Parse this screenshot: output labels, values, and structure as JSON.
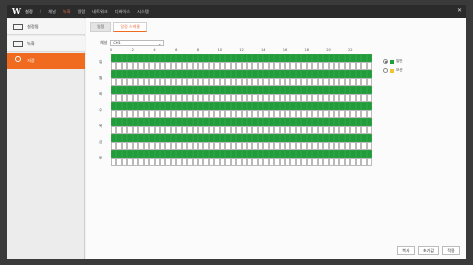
{
  "header": {
    "logo": "W",
    "menu": [
      {
        "label": "설정",
        "style": "group"
      },
      {
        "label": "/",
        "style": "sep"
      },
      {
        "label": "채널",
        "style": "normal"
      },
      {
        "label": "녹화",
        "style": "active"
      },
      {
        "label": "알람",
        "style": "normal"
      },
      {
        "label": "네트워크",
        "style": "normal"
      },
      {
        "label": "디바이스",
        "style": "normal"
      },
      {
        "label": "시스템",
        "style": "normal"
      }
    ]
  },
  "sidebar": {
    "items": [
      {
        "label": "설정됨",
        "icon": "monitor-icon"
      },
      {
        "label": "녹화",
        "icon": "camera-icon"
      },
      {
        "label": "저장",
        "icon": "disk-icon",
        "active": true
      }
    ]
  },
  "tabs": [
    {
      "label": "일정",
      "active": false
    },
    {
      "label": "일정 스케줄",
      "active": true
    }
  ],
  "channel": {
    "label": "채널",
    "value": "CH1"
  },
  "hours": [
    "0",
    "2",
    "4",
    "6",
    "8",
    "10",
    "12",
    "14",
    "16",
    "18",
    "20",
    "22"
  ],
  "days": [
    "일",
    "월",
    "화",
    "수",
    "목",
    "금",
    "토"
  ],
  "schedule": {
    "cells_per_day": 48,
    "recorded_rows": [
      true,
      false,
      true,
      false,
      true,
      false,
      true,
      false,
      true,
      false,
      true,
      false,
      true,
      false
    ]
  },
  "legend": [
    {
      "label": "일반",
      "color": "#1f9d3a",
      "checked": true
    },
    {
      "label": "모션",
      "color": "#f2c230",
      "checked": false
    }
  ],
  "footer": {
    "buttons": [
      "복사",
      "초기값",
      "적용"
    ]
  }
}
